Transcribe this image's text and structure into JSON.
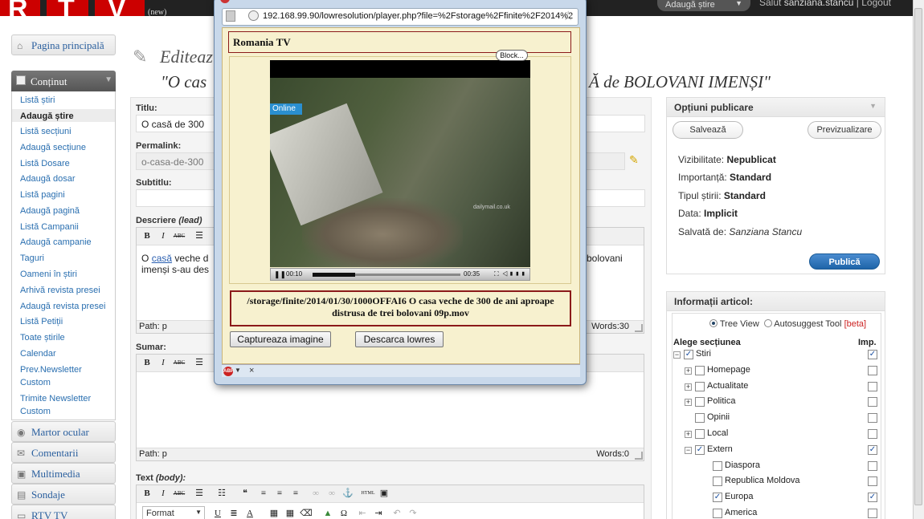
{
  "topbar": {
    "logo_letters": [
      "R",
      "T",
      "V"
    ],
    "logo_suffix": "(new)",
    "add_news_label": "Adaugă știre",
    "greeting_prefix": "Salut",
    "user_name": "sanziana.stancu",
    "separator": "|",
    "logout_label": "Logout"
  },
  "sidebar": {
    "home_label": "Pagina principală",
    "content_label": "Conținut",
    "submenu": [
      "Listă știri",
      "Adaugă știre",
      "Listă secțiuni",
      "Adaugă secțiune",
      "Listă Dosare",
      "Adaugă dosar",
      "Listă pagini",
      "Adaugă pagină",
      "Listă Campanii",
      "Adaugă campanie",
      "Taguri",
      "Oameni în știri",
      "Arhivă revista presei",
      "Adaugă revista presei",
      "Listă Petiții",
      "Toate știrile",
      "Calendar",
      "Prev.Newsletter",
      "Custom",
      "Trimite Newsletter",
      "Custom"
    ],
    "sections": [
      "Martor ocular",
      "Comentarii",
      "Multimedia",
      "Sondaje",
      "RTV TV"
    ]
  },
  "header": {
    "title": "Editeaz",
    "subtitle_left": "\"O cas",
    "subtitle_right": "Ă de BOLOVANI IMENȘI\""
  },
  "form": {
    "title_label": "Titlu:",
    "title_value": "O casă de 300",
    "permalink_label": "Permalink:",
    "permalink_value": "o-casa-de-300",
    "subtitle_label": "Subtitlu:",
    "subtitle_value": "",
    "description_label": "Descriere",
    "description_qualifier": "(lead)",
    "description_text_1": "O",
    "description_link": "casă",
    "description_text_2": "veche d",
    "description_text_3": "imenși s-au des",
    "description_text_right": "bolovani",
    "description_path": "Path: p",
    "description_words": "Words:30",
    "summary_label": "Sumar:",
    "summary_path": "Path: p",
    "summary_words": "Words:0",
    "body_label": "Text",
    "body_qualifier": "(body):",
    "format_label": "Format",
    "toolbar": {
      "bold": "B",
      "italic": "I",
      "strike": "ABC",
      "quote": "❝",
      "html": "HTML",
      "omega": "Ω"
    }
  },
  "publish": {
    "header": "Opțiuni publicare",
    "save_label": "Salvează",
    "preview_label": "Previzualizare",
    "rows": [
      {
        "label": "Vizibilitate:",
        "value": "Nepublicat",
        "italic": false
      },
      {
        "label": "Importanță:",
        "value": "Standard",
        "italic": false
      },
      {
        "label": "Tipul știrii:",
        "value": "Standard",
        "italic": false
      },
      {
        "label": "Data:",
        "value": "Implicit",
        "italic": false
      },
      {
        "label": "Salvată de:",
        "value": "Sanziana Stancu",
        "italic": true
      }
    ],
    "publish_label": "Publică"
  },
  "article_info": {
    "header": "Informații articol",
    "tree_view_label": "Tree View",
    "autosuggest_label": "Autosuggest Tool",
    "beta_label": "[beta]",
    "section_header": "Alege secțiunea",
    "imp_header": "Imp.",
    "sections": [
      {
        "name": "Stiri",
        "level": 0,
        "exp": "−",
        "checked": true,
        "imp": true
      },
      {
        "name": "Homepage",
        "level": 1,
        "exp": "+",
        "checked": false,
        "imp": false
      },
      {
        "name": "Actualitate",
        "level": 1,
        "exp": "+",
        "checked": false,
        "imp": false
      },
      {
        "name": "Politica",
        "level": 1,
        "exp": "+",
        "checked": false,
        "imp": false
      },
      {
        "name": "Opinii",
        "level": 1,
        "exp": "",
        "checked": false,
        "imp": false
      },
      {
        "name": "Local",
        "level": 1,
        "exp": "+",
        "checked": false,
        "imp": false
      },
      {
        "name": "Extern",
        "level": 1,
        "exp": "−",
        "checked": true,
        "imp": true
      },
      {
        "name": "Diaspora",
        "level": 2,
        "exp": "",
        "checked": false,
        "imp": false
      },
      {
        "name": "Republica Moldova",
        "level": 2,
        "exp": "",
        "checked": false,
        "imp": false
      },
      {
        "name": "Europa",
        "level": 2,
        "exp": "",
        "checked": true,
        "imp": true
      },
      {
        "name": "America",
        "level": 2,
        "exp": "",
        "checked": false,
        "imp": false
      }
    ]
  },
  "popup": {
    "url": "192.168.99.90/lowresolution/player.php?file=%2Fstorage%2Ffinite%2F2014%2",
    "title": "Romania TV",
    "block_label": "Block...",
    "video_logo": "Online",
    "video_watermark": "dailymail.co.uk",
    "time_current": "00:10",
    "time_total": "00:35",
    "progress": 0.29,
    "file_path": "/storage/finite/2014/01/30/1000OFFAI6 O casa veche de 300 de ani aproape distrusa de trei bolovani 09p.mov",
    "capture_label": "Captureaza imagine",
    "download_label": "Descarca lowres",
    "abp_label": "ABP",
    "status_close": "×"
  }
}
